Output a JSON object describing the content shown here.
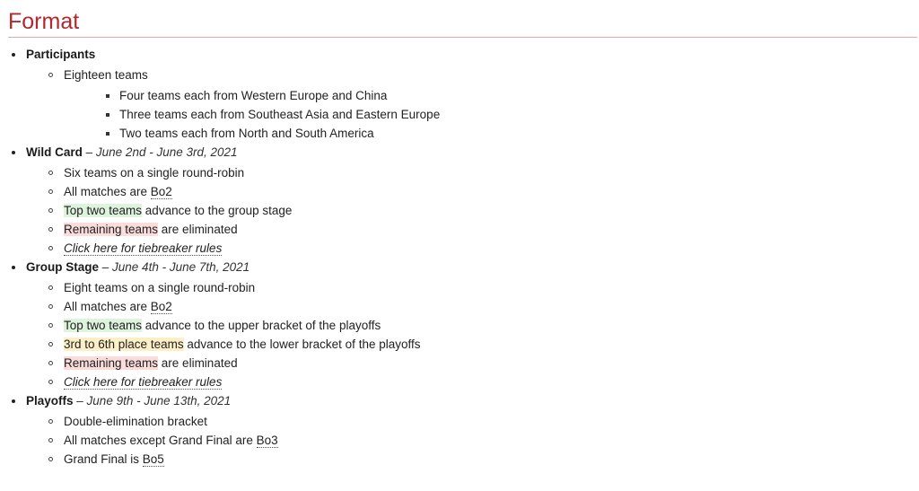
{
  "section": {
    "title": "Format",
    "accent_color": "#b3282d",
    "divider_color": "#e9a7a7"
  },
  "highlight_colors": {
    "advance": "#ddf3dc",
    "lower_bracket": "#fcefc6",
    "eliminated": "#fadcdb"
  },
  "participants": {
    "label": "Participants",
    "summary": "Eighteen teams",
    "regions": [
      "Four teams each from Western Europe and China",
      "Three teams each from Southeast Asia and Eastern Europe",
      "Two teams each from North and South America"
    ]
  },
  "wild_card": {
    "label": "Wild Card",
    "separator": " – ",
    "dates": "June 2nd - June 3rd, 2021",
    "items": {
      "format": "Six teams on a single round-robin",
      "matches_prefix": "All matches are ",
      "matches_abbr": "Bo2",
      "advance_highlight": "Top two teams",
      "advance_rest": " advance to the group stage",
      "elim_highlight": "Remaining teams",
      "elim_rest": " are eliminated",
      "tiebreaker_link": "Click here for tiebreaker rules"
    }
  },
  "group_stage": {
    "label": "Group Stage",
    "separator": " – ",
    "dates": "June 4th - June 7th, 2021",
    "items": {
      "format": "Eight teams on a single round-robin",
      "matches_prefix": "All matches are ",
      "matches_abbr": "Bo2",
      "upper_highlight": "Top two teams",
      "upper_rest": " advance to the upper bracket of the playoffs",
      "lower_highlight": "3rd to 6th place teams",
      "lower_rest": " advance to the lower bracket of the playoffs",
      "elim_highlight": "Remaining teams",
      "elim_rest": " are eliminated",
      "tiebreaker_link": "Click here for tiebreaker rules"
    }
  },
  "playoffs": {
    "label": "Playoffs",
    "separator": " – ",
    "dates": "June 9th - June 13th, 2021",
    "items": {
      "format": "Double-elimination bracket",
      "matches_prefix": "All matches except Grand Final are ",
      "matches_abbr": "Bo3",
      "final_prefix": "Grand Final is ",
      "final_abbr": "Bo5"
    }
  }
}
